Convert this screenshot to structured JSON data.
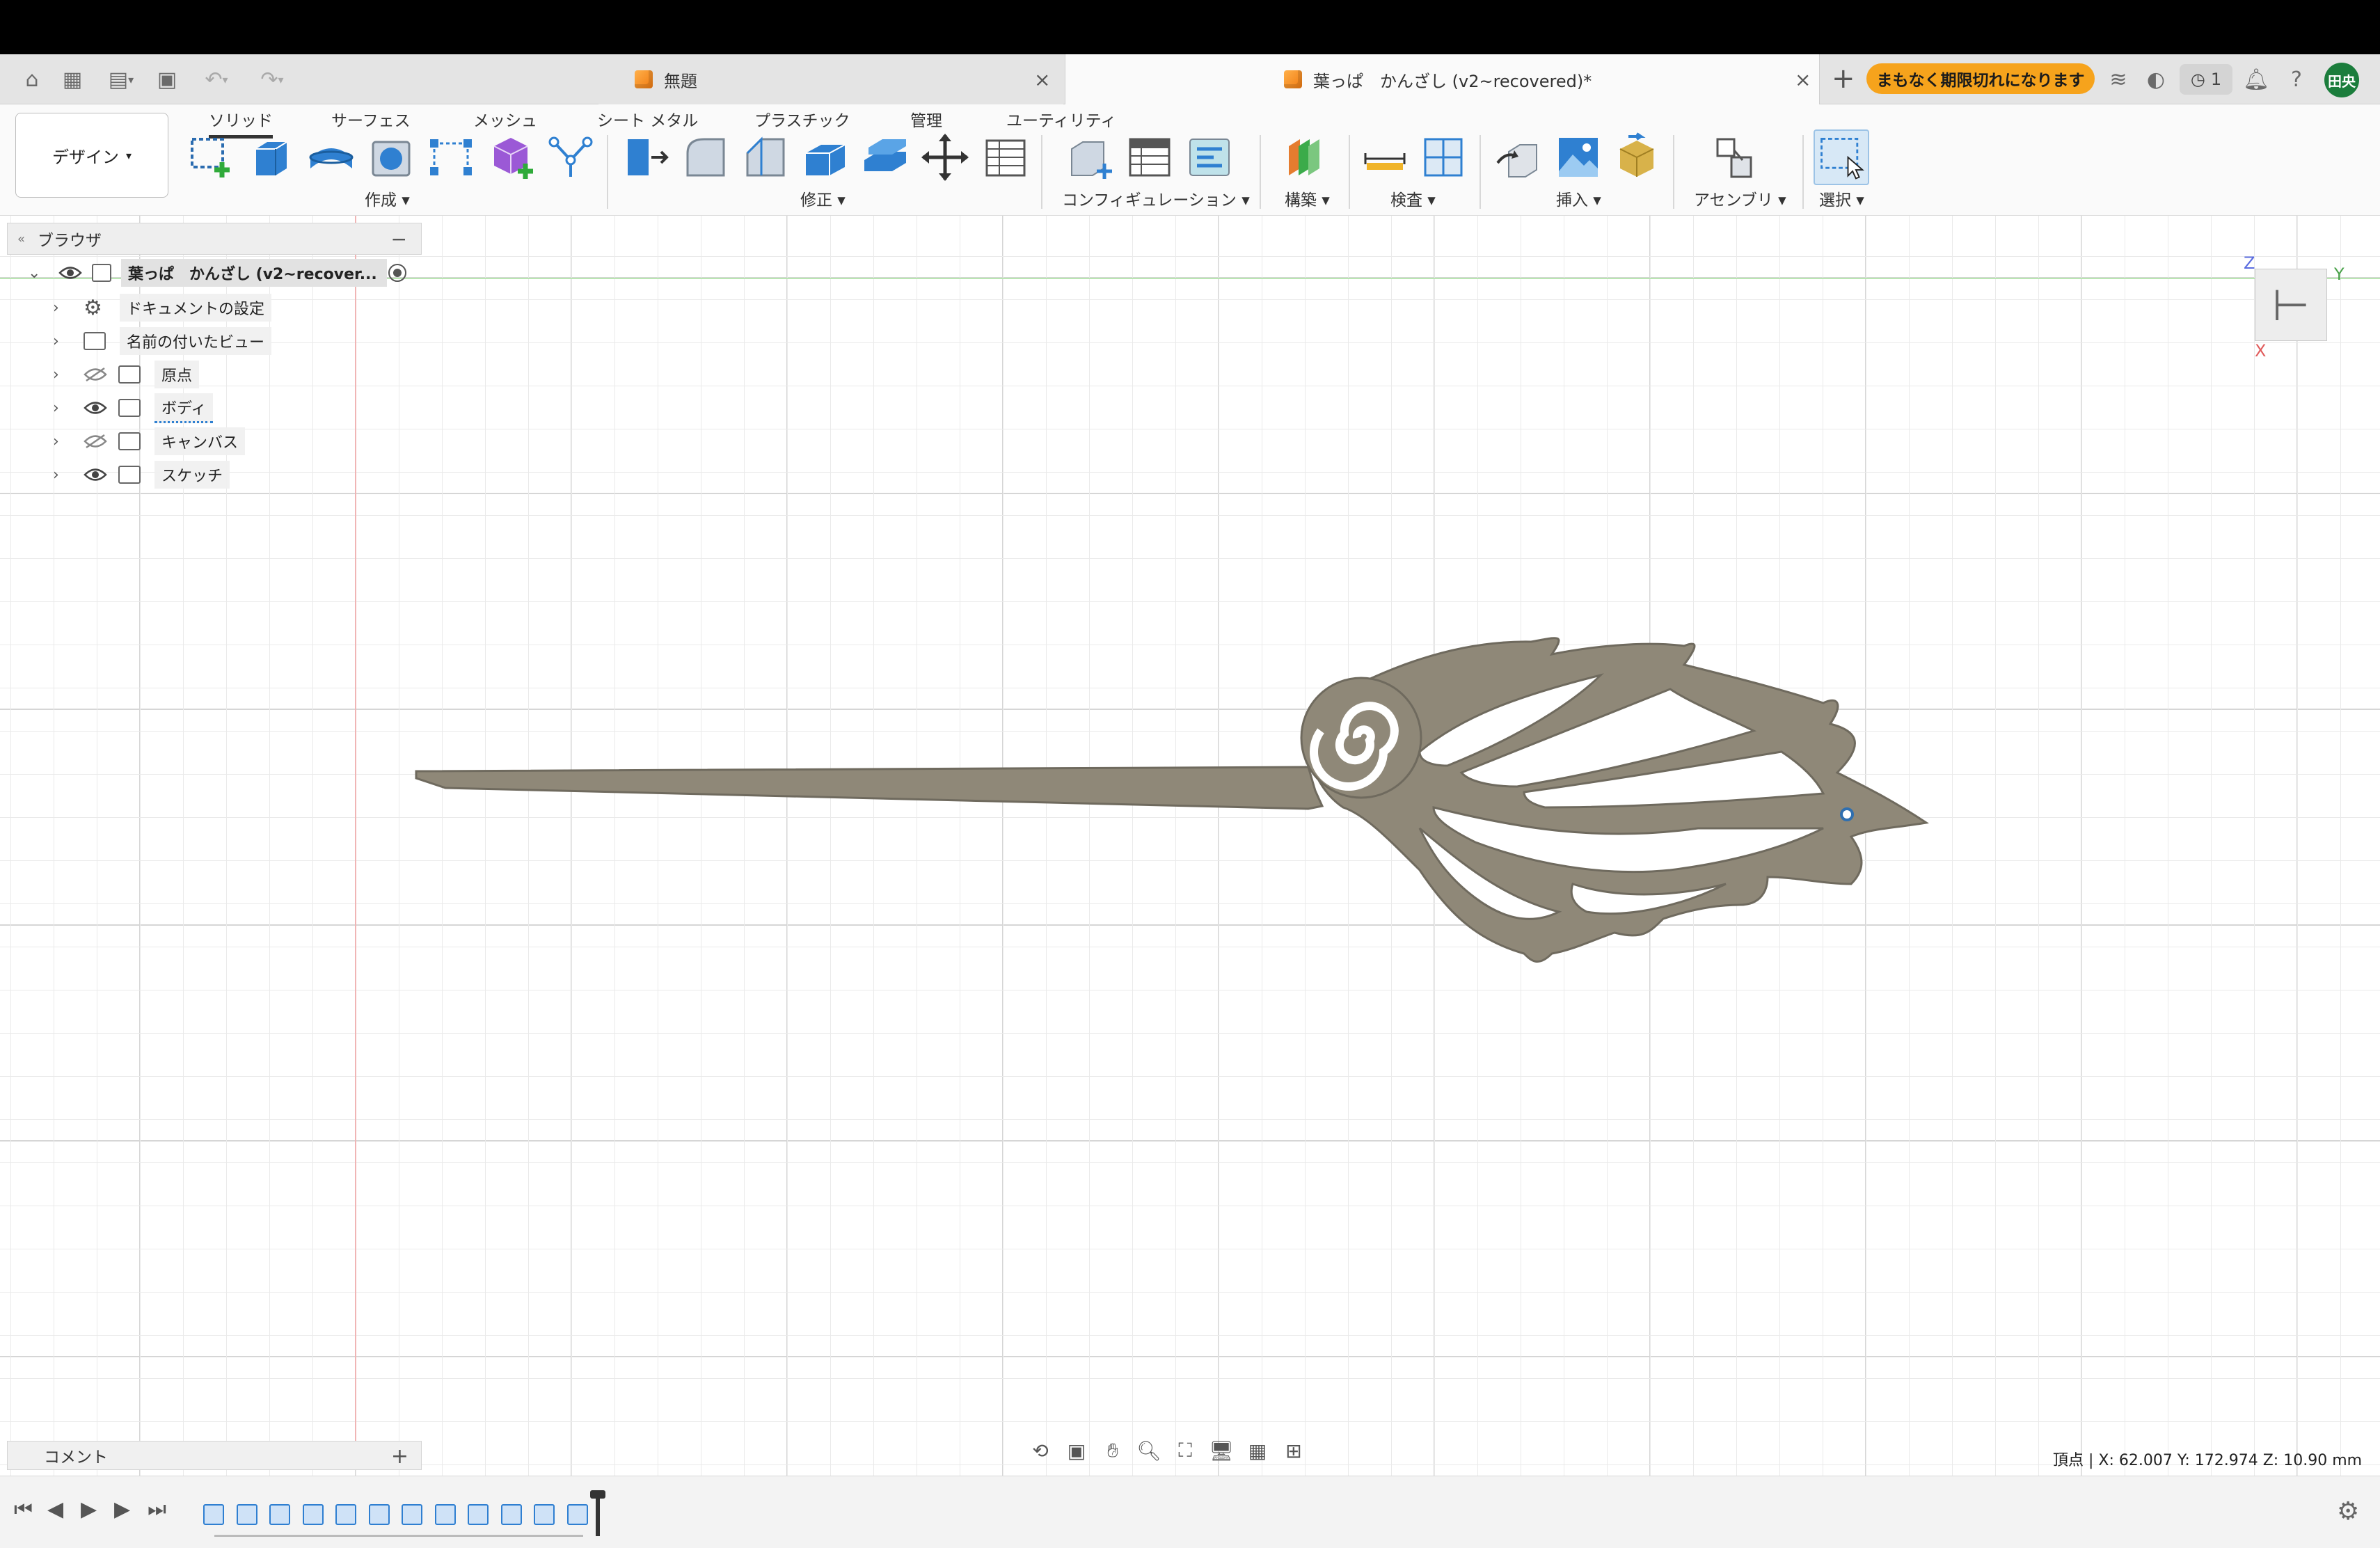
{
  "tabs": {
    "inactive_title": "無題",
    "active_title": "葉っぱ　かんざし (v2~recovered)*"
  },
  "header": {
    "expiry_badge": "まもなく期限切れになります",
    "jobs_count": "1",
    "avatar_initials": "田央"
  },
  "toolbar": {
    "workspace_label": "デザイン",
    "ribbon_tabs": [
      "ソリッド",
      "サーフェス",
      "メッシュ",
      "シート メタル",
      "プラスチック",
      "管理",
      "ユーティリティ"
    ],
    "groups": {
      "create": "作成",
      "modify": "修正",
      "configure": "コンフィギュレーション",
      "construct": "構築",
      "inspect": "検査",
      "insert": "挿入",
      "assemble": "アセンブリ",
      "select": "選択"
    }
  },
  "browser": {
    "title": "ブラウザ",
    "root": "葉っぱ　かんざし (v2~recover...",
    "items": [
      {
        "label": "ドキュメントの設定",
        "icon": "gear-icon",
        "visible": true
      },
      {
        "label": "名前の付いたビュー",
        "icon": "folder-icon",
        "visible": true
      },
      {
        "label": "原点",
        "icon": "folder-icon",
        "visible": false
      },
      {
        "label": "ボディ",
        "icon": "folder-icon",
        "visible": true
      },
      {
        "label": "キャンバス",
        "icon": "folder-icon",
        "visible": false
      },
      {
        "label": "スケッチ",
        "icon": "folder-icon",
        "visible": true
      }
    ]
  },
  "comments": {
    "label": "コメント"
  },
  "viewport": {
    "vertex_readout": "頂点 | X: 62.007 Y: 172.974 Z: 10.90 mm",
    "axis_labels": {
      "z": "Z",
      "y": "Y",
      "x": "X"
    },
    "body_color": "#8f8878"
  },
  "timeline": {
    "feature_count": 12
  }
}
